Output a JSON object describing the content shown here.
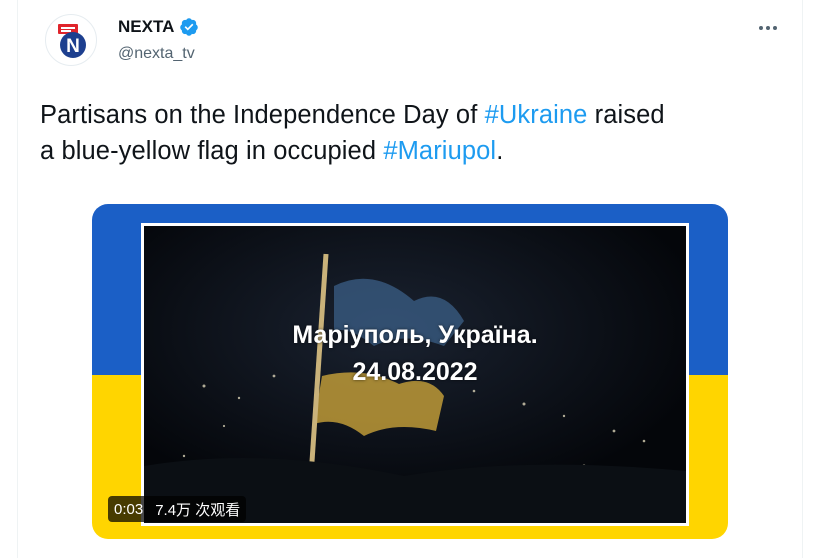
{
  "author": {
    "name": "NEXTA",
    "handle": "@nexta_tv",
    "verified_icon": "verified-badge-icon",
    "brand_color": "#1d9bf0"
  },
  "more_icon": "more-horizontal-icon",
  "tweet": {
    "part1": "Partisans on the Independence Day of ",
    "hashtag1": "#Ukraine",
    "part2": " raised",
    "part3": "a blue-yellow flag in occupied ",
    "hashtag2": "#Mariupol",
    "part4": "."
  },
  "media": {
    "overlay_line1": "Маріуполь, Україна.",
    "overlay_line2": "24.08.2022",
    "duration": "0:03",
    "views": "7.4万 次观看",
    "flag_blue": "#1b5fc6",
    "flag_yellow": "#ffd500"
  }
}
